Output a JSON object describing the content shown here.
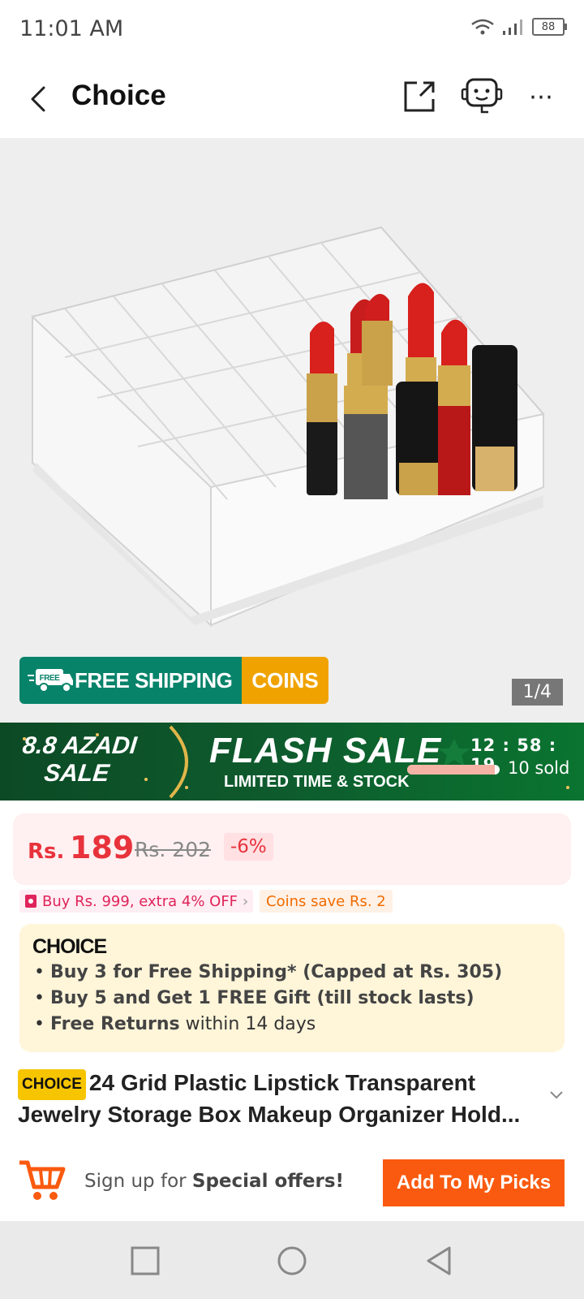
{
  "status_bar": {
    "time": "11:01 AM",
    "battery": "88"
  },
  "header": {
    "title": "Choice"
  },
  "gallery": {
    "counter": "1/4"
  },
  "promo": {
    "free_shipping": "FREE SHIPPING",
    "coins": "COINS",
    "free_tag": "FREE"
  },
  "flash_sale": {
    "campaign_line1": "8.8 AZADI",
    "campaign_line2": "SALE",
    "title": "FLASH SALE",
    "subtitle": "LIMITED TIME & STOCK",
    "countdown": "12 : 58 : 19",
    "sold": "10 sold",
    "sold_fraction": 0.95
  },
  "price": {
    "currency": "Rs.",
    "value": "189",
    "original": "Rs. 202",
    "discount": "-6%"
  },
  "coupons": {
    "extra_off": "Buy Rs. 999, extra 4% OFF",
    "coins_save": "Coins save Rs. 2"
  },
  "choice": {
    "logo": "CHOICE",
    "items": [
      {
        "bold": "Buy 3 for  Free Shipping* (Capped at Rs. 305)",
        "rest": ""
      },
      {
        "bold": "Buy 5 and Get 1 FREE Gift (till stock lasts)",
        "rest": ""
      },
      {
        "bold": "Free Returns",
        "rest": " within 14 days"
      }
    ]
  },
  "product": {
    "tag": "CHOICE",
    "title": "24 Grid Plastic Lipstick Transparent Jewelry Storage Box Makeup Organizer Hold..."
  },
  "bottom_bar": {
    "signup_prefix": "Sign up for ",
    "signup_bold": "Special offers!",
    "button": "Add To My Picks"
  },
  "colors": {
    "accent": "#fa5a0f",
    "price": "#e8333c",
    "choice_yellow": "#f6c500",
    "shipping_green": "#07836a"
  }
}
